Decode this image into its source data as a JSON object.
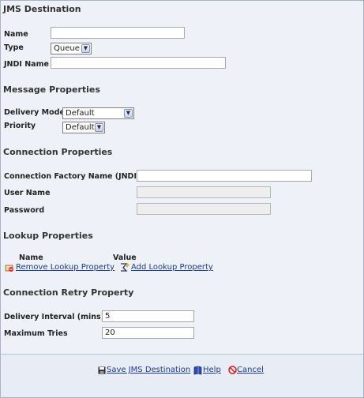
{
  "sections": {
    "jms_destination": "JMS Destination",
    "message_properties": "Message Properties",
    "connection_properties": "Connection Properties",
    "lookup_properties": "Lookup Properties",
    "connection_retry": "Connection Retry Property"
  },
  "jms": {
    "name_label": "Name",
    "name_value": "",
    "type_label": "Type",
    "type_value": "Queue",
    "jndi_label": "JNDI Name",
    "jndi_value": ""
  },
  "message": {
    "delivery_mode_label": "Delivery Mode",
    "delivery_mode_value": "Default",
    "priority_label": "Priority",
    "priority_value": "Default"
  },
  "connection": {
    "factory_label": "Connection Factory Name (JNDI)",
    "factory_value": "",
    "user_label": "User Name",
    "user_value": "",
    "password_label": "Password",
    "password_value": ""
  },
  "lookup": {
    "col_name": "Name",
    "col_value": "Value",
    "remove_label": "Remove Lookup Property",
    "add_label": "Add Lookup Property"
  },
  "retry": {
    "interval_label": "Delivery Interval (mins)",
    "interval_value": "5",
    "max_tries_label": "Maximum Tries",
    "max_tries_value": "20"
  },
  "footer": {
    "save_label": "Save JMS Destination",
    "help_label": "Help",
    "cancel_label": "Cancel"
  },
  "colors": {
    "link": "#1a3a8f",
    "panel_bg": "#eef1f7",
    "border": "#a9b3c6"
  }
}
